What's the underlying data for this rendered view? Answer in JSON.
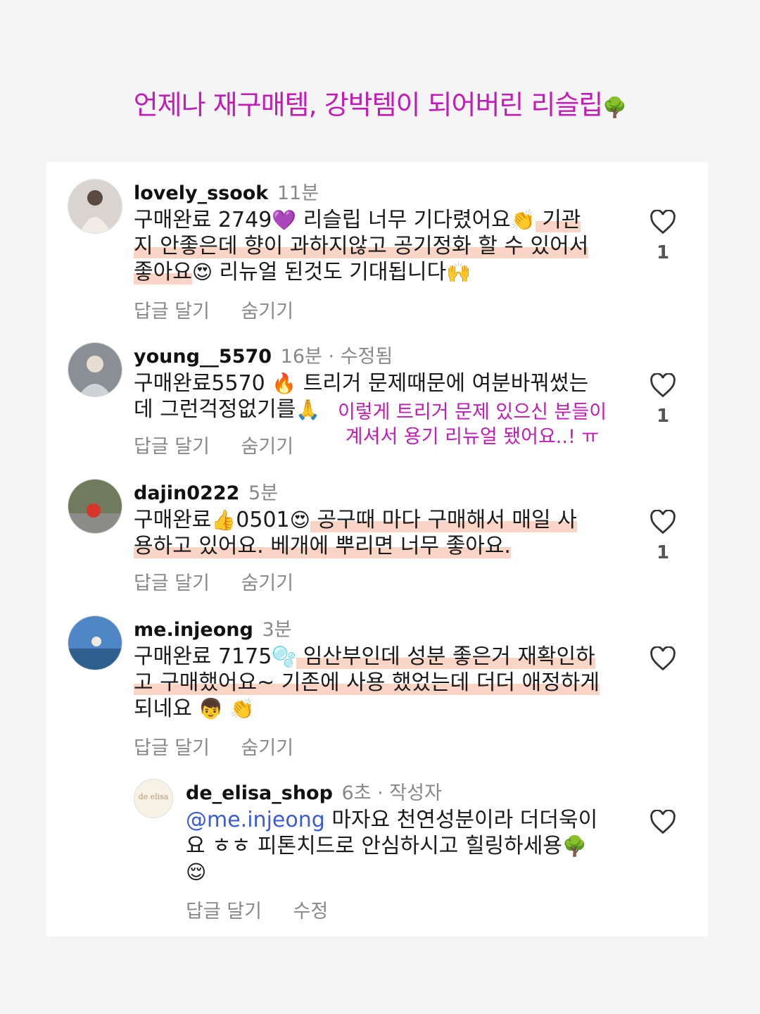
{
  "headline": "언제나 재구매템, 강박템이 되어버린 리슬립",
  "headline_emoji": "🌳",
  "comments": [
    {
      "user": "lovely_ssook",
      "time": "11분",
      "lines": [
        "구매완료 2749",
        "💜",
        " 리슬립 너무 기다렸어요",
        "👏",
        " 기관",
        "지 안좋은데 향이 과하지않고 공기정화 할 수 있어서",
        "좋아요",
        "😍",
        " 리뉴얼 된것도 기대됩니다",
        "🙌"
      ],
      "reply": "답글 달기",
      "hide": "숨기기",
      "likes": "1"
    },
    {
      "user": "young__5570",
      "time": "16분",
      "tag": "· 수정됨",
      "lines": [
        "구매완료5570 ",
        "🔥",
        " 트리거 문제때문에 여분바꿔썼는",
        "데 그런걱정없기를",
        "🙏"
      ],
      "annotation_1": "이렇게 트리거 문제 있으신 분들이",
      "annotation_2": "계셔서 용기 리뉴얼 됐어요..! ㅠ",
      "reply": "답글 달기",
      "hide": "숨기기",
      "likes": "1"
    },
    {
      "user": "dajin0222",
      "time": "5분",
      "lines": [
        "구매완료",
        "👍",
        "0501",
        "😍",
        " 공구때 마다 구매해서 매일 사",
        "용하고 있어요.  베개에 뿌리면 너무 좋아요."
      ],
      "reply": "답글 달기",
      "hide": "숨기기",
      "likes": "1"
    },
    {
      "user": "me.injeong",
      "time": "3분",
      "lines": [
        "구매완료 7175",
        "🫧",
        " 임산부인데 성분 좋은거 재확인하",
        "고 구매했어요~ 기존에 사용 했었는데 더더 애정하게",
        "되네요 ",
        "👦",
        " ",
        "👏"
      ],
      "reply": "답글 달기",
      "hide": "숨기기"
    }
  ],
  "owner_reply": {
    "avatar_text": "de elisa",
    "user": "de_elisa_shop",
    "time": "6초",
    "tag": "· 작성자",
    "mention": "@me.injeong",
    "line1": " 마자요 천연성분이라 더더욱이",
    "line2": "요 ㅎㅎ 피톤치드로 안심하시고 힐링하세용",
    "line2_emoji": "🌳",
    "line3_emoji": "😌",
    "reply": "답글 달기",
    "edit": "수정"
  }
}
